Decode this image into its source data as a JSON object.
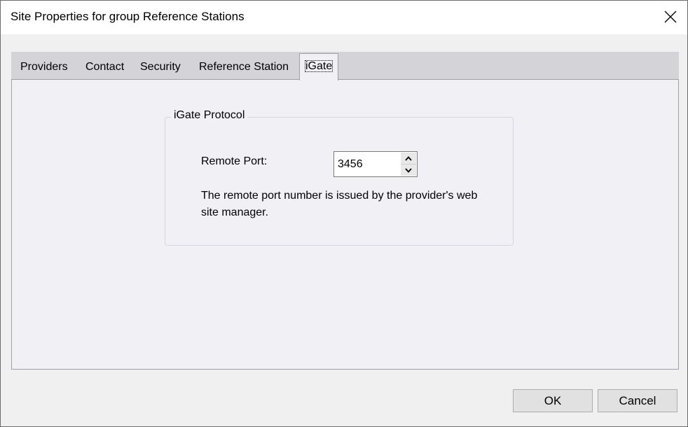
{
  "window": {
    "title": "Site Properties for group Reference Stations"
  },
  "tabs": [
    {
      "label": "Providers",
      "active": false
    },
    {
      "label": "Contact",
      "active": false
    },
    {
      "label": "Security",
      "active": false
    },
    {
      "label": "Reference Station",
      "active": false
    },
    {
      "label": "iGate",
      "active": true
    }
  ],
  "group": {
    "legend": "iGate Protocol",
    "remote_port_label": "Remote Port:",
    "remote_port_value": "3456",
    "help_text": "The remote port number is issued by the provider's web site manager."
  },
  "buttons": {
    "ok": "OK",
    "cancel": "Cancel"
  },
  "icons": {
    "close": "close-icon",
    "spin_up": "chevron-up-icon",
    "spin_down": "chevron-down-icon"
  }
}
